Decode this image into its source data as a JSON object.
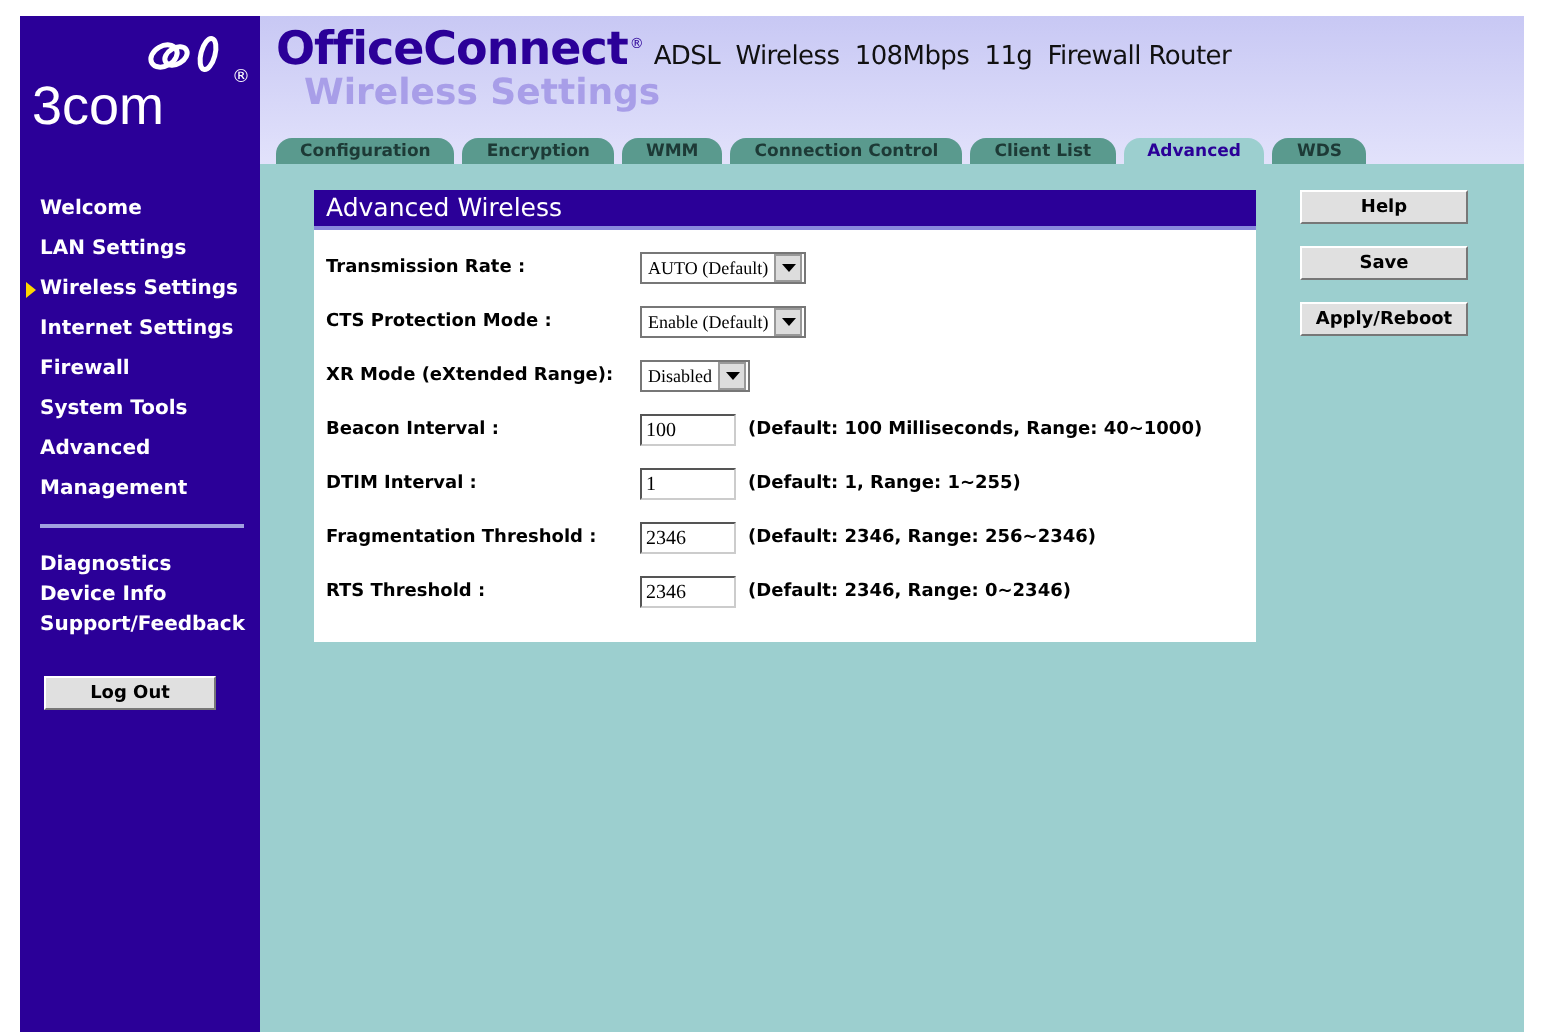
{
  "logo": {
    "text": "3com",
    "registered": "®"
  },
  "header": {
    "product": "OfficeConnect",
    "registered": "®",
    "subtitle": "ADSL  Wireless  108Mbps  11g  Firewall Router",
    "page_title": "Wireless Settings"
  },
  "tabs": [
    {
      "label": "Configuration",
      "selected": false
    },
    {
      "label": "Encryption",
      "selected": false
    },
    {
      "label": "WMM",
      "selected": false
    },
    {
      "label": "Connection Control",
      "selected": false
    },
    {
      "label": "Client List",
      "selected": false
    },
    {
      "label": "Advanced",
      "selected": true
    },
    {
      "label": "WDS",
      "selected": false
    }
  ],
  "sidebar": {
    "items": [
      {
        "label": "Welcome",
        "selected": false
      },
      {
        "label": "LAN Settings",
        "selected": false
      },
      {
        "label": "Wireless Settings",
        "selected": true
      },
      {
        "label": "Internet Settings",
        "selected": false
      },
      {
        "label": "Firewall",
        "selected": false
      },
      {
        "label": "System Tools",
        "selected": false
      },
      {
        "label": "Advanced",
        "selected": false
      },
      {
        "label": "Management",
        "selected": false
      }
    ],
    "secondary_items": [
      {
        "label": "Diagnostics"
      },
      {
        "label": "Device Info"
      },
      {
        "label": "Support/Feedback"
      }
    ],
    "logout_button": "Log Out"
  },
  "panel": {
    "title": "Advanced Wireless",
    "rows": [
      {
        "kind": "select",
        "label": "Transmission Rate :",
        "value": "AUTO (Default)"
      },
      {
        "kind": "select",
        "label": "CTS Protection Mode :",
        "value": "Enable (Default)"
      },
      {
        "kind": "select",
        "label": "XR Mode (eXtended Range):",
        "value": "Disabled"
      },
      {
        "kind": "input",
        "label": "Beacon Interval :",
        "value": "100",
        "hint": "(Default: 100 Milliseconds, Range: 40~1000)"
      },
      {
        "kind": "input",
        "label": "DTIM Interval :",
        "value": "1",
        "hint": "(Default: 1, Range: 1~255)"
      },
      {
        "kind": "input",
        "label": "Fragmentation Threshold :",
        "value": "2346",
        "hint": "(Default: 2346, Range: 256~2346)"
      },
      {
        "kind": "input",
        "label": "RTS Threshold :",
        "value": "2346",
        "hint": "(Default: 2346, Range: 0~2346)"
      }
    ]
  },
  "buttons": [
    "Help",
    "Save",
    "Apply/Reboot"
  ]
}
